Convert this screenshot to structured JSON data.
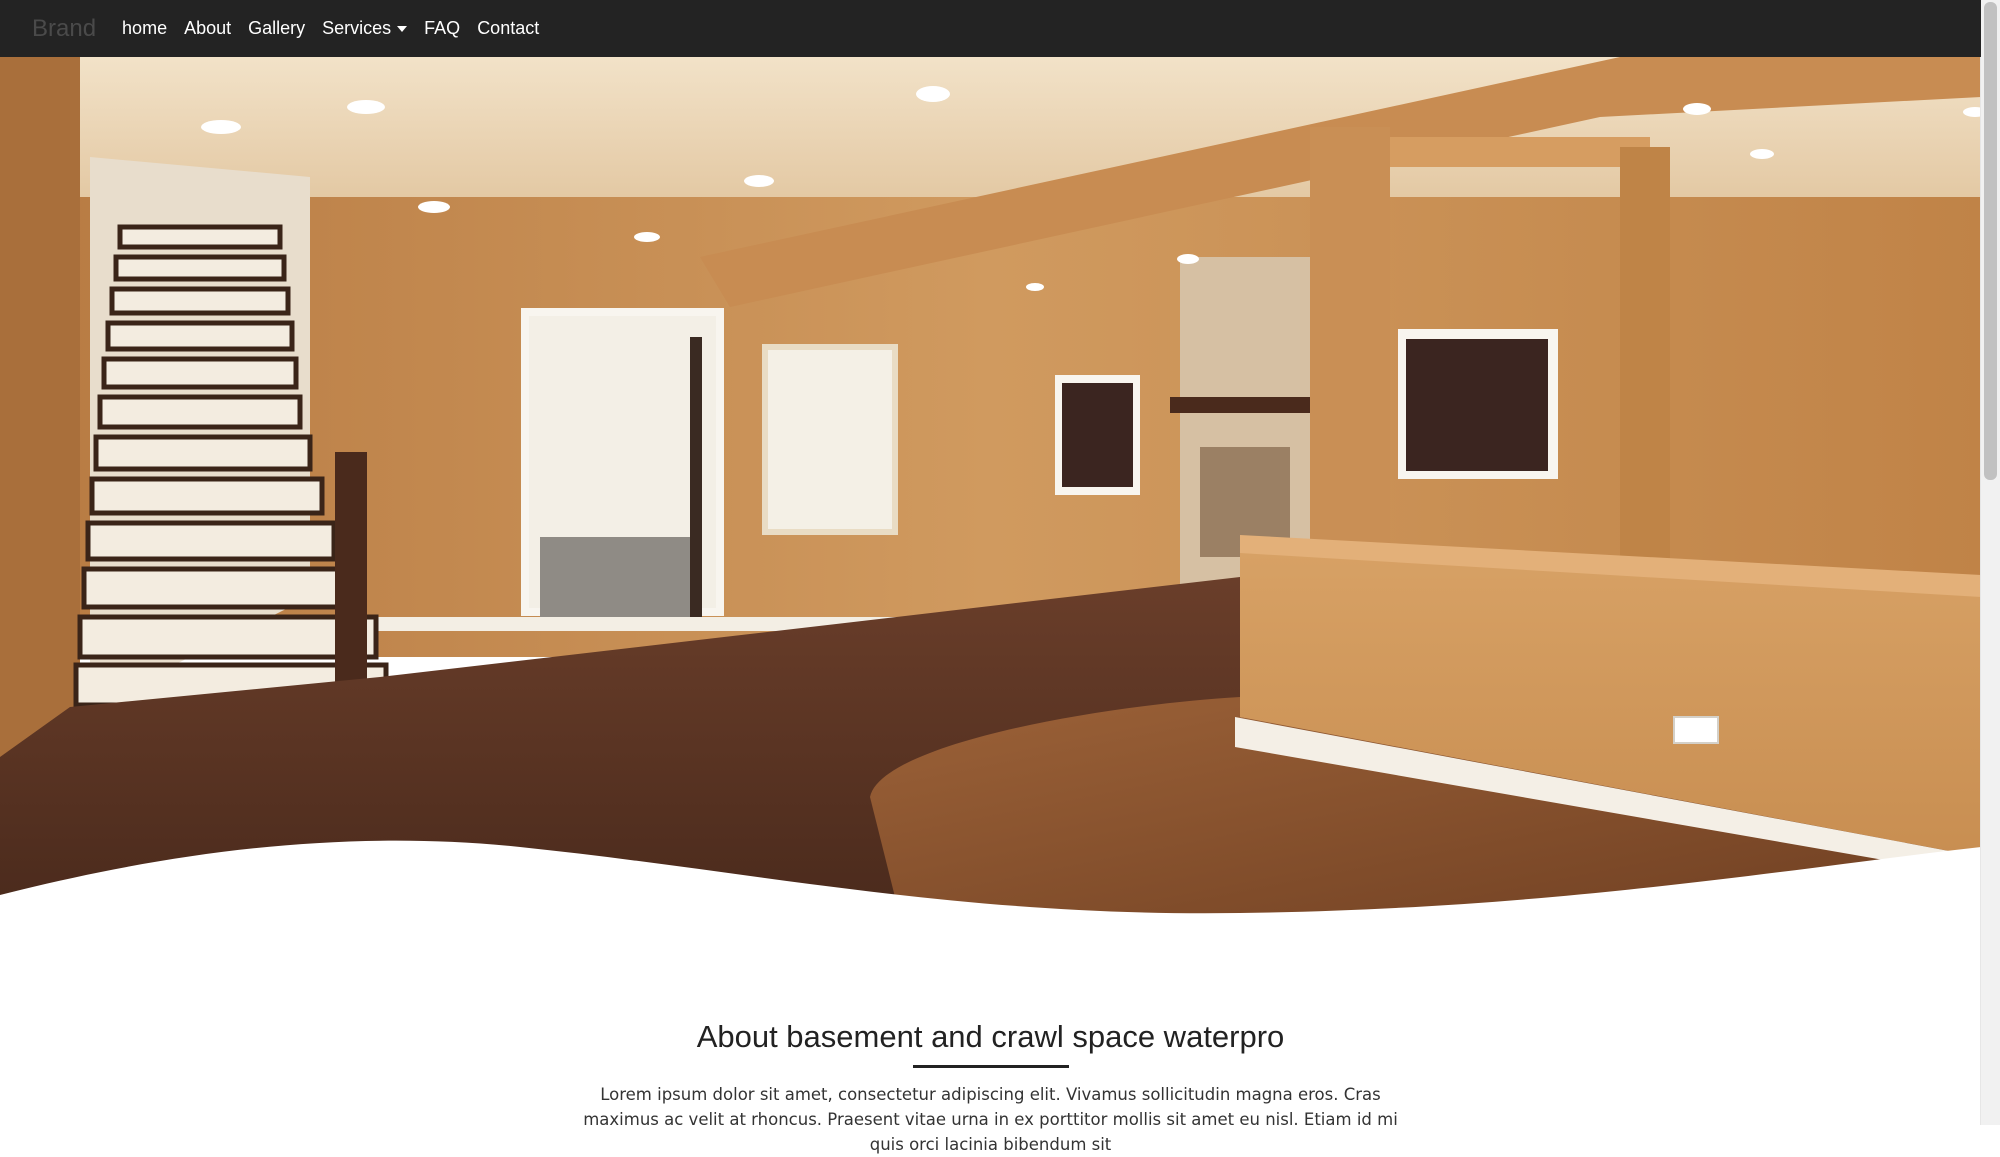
{
  "navbar": {
    "brand": "Brand",
    "items": [
      {
        "label": "home"
      },
      {
        "label": "About"
      },
      {
        "label": "Gallery"
      },
      {
        "label": "Services",
        "dropdown": true
      },
      {
        "label": "FAQ"
      },
      {
        "label": "Contact"
      }
    ]
  },
  "about": {
    "title": "About basement and crawl space waterpro",
    "text": "Lorem ipsum dolor sit amet, consectetur adipiscing elit. Vivamus sollicitudin magna eros. Cras maximus ac velit at rhoncus. Praesent vitae urna in ex porttitor mollis sit amet eu nisl. Etiam id mi quis orci lacinia bibendum sit"
  },
  "colors": {
    "navbar_bg": "#232323",
    "wall": "#c98f55",
    "carpet": "#5a3424",
    "wood_floor": "#8a5532"
  }
}
